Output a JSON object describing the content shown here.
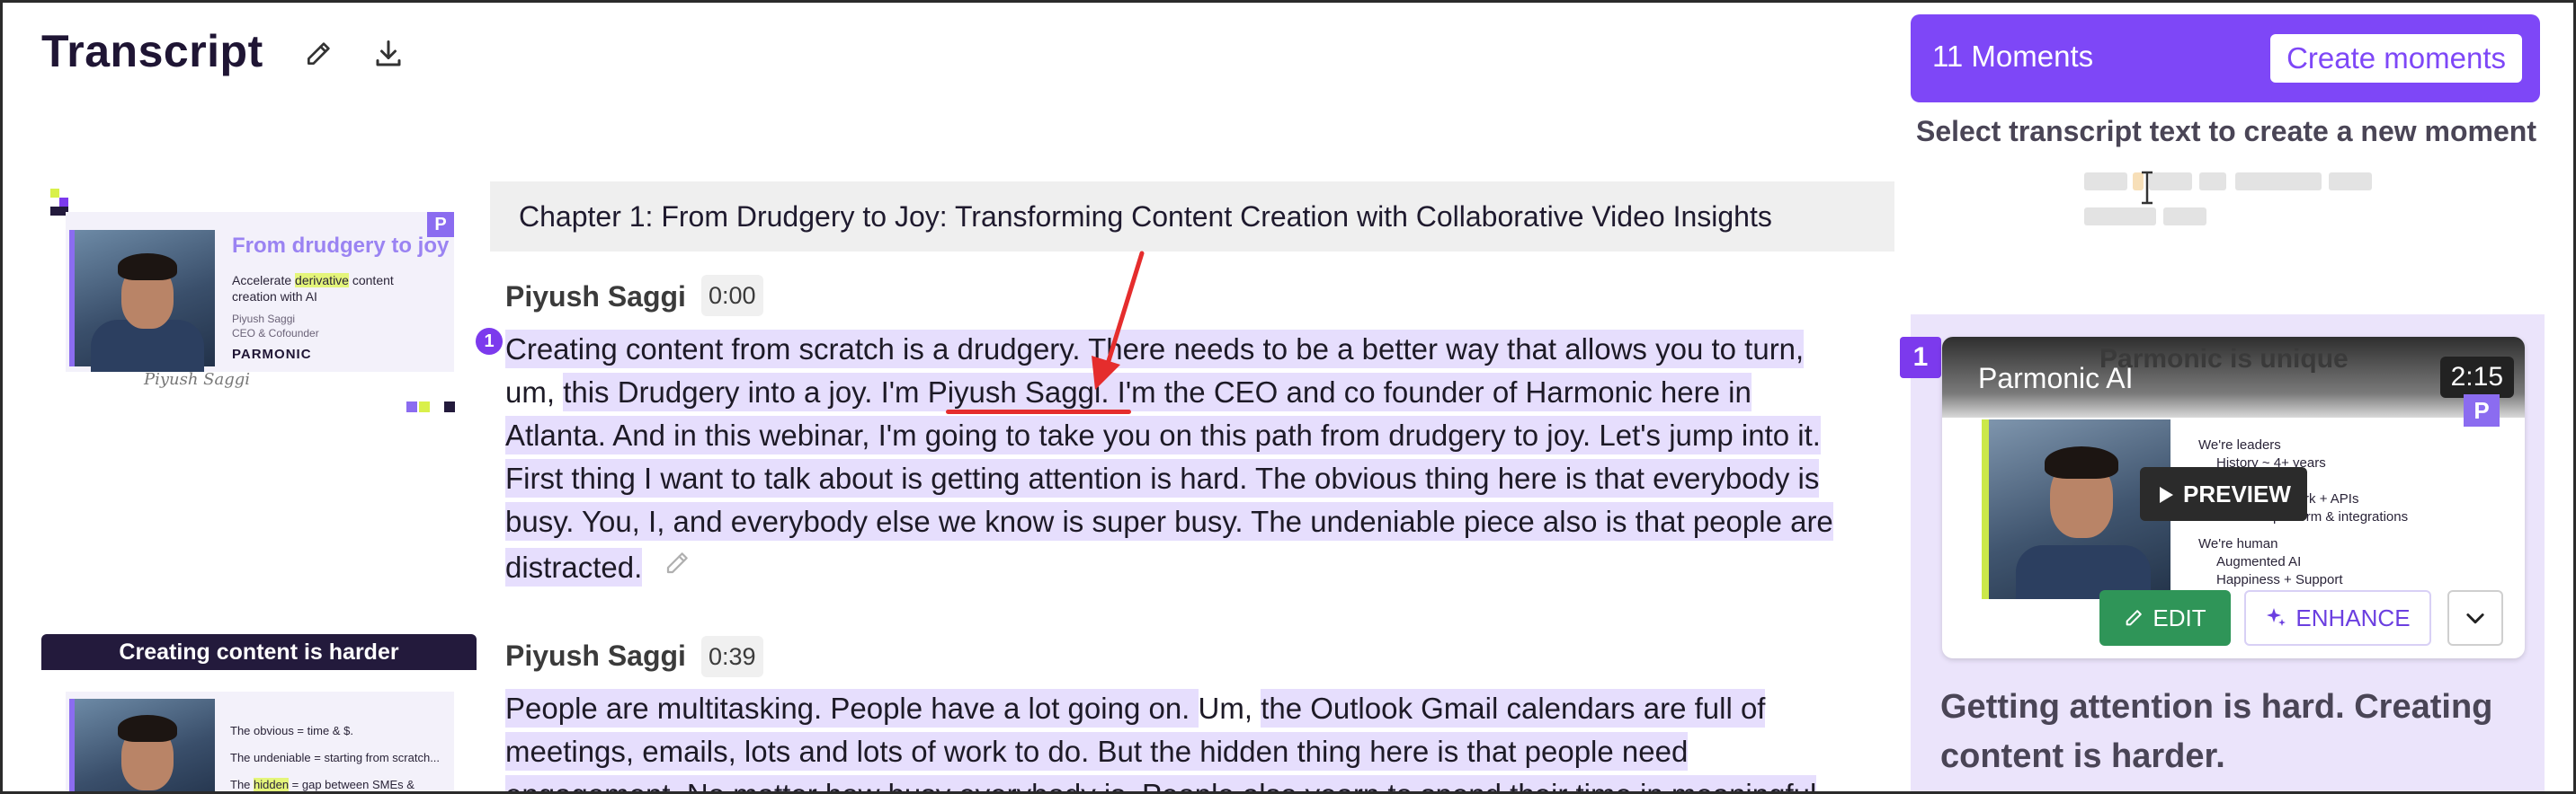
{
  "header": {
    "title": "Transcript",
    "edit_icon": "pencil-icon",
    "download_icon": "download-icon"
  },
  "thumbnails": [
    {
      "title": "From drudgery to joy",
      "line1_before": "Accelerate ",
      "line1_highlight": "derivative",
      "line1_after": " content",
      "line2": "creation with AI",
      "name": "Piyush Saggi",
      "role": "CEO & Cofounder",
      "brand": "PARMONIC",
      "badge": "P",
      "signature": "Piyush Saggi"
    },
    {
      "heading": "Creating content is harder",
      "line1": "The obvious = time & $.",
      "line2": "The undeniable = starting from scratch...",
      "line3_before": "The ",
      "line3_highlight": "hidden",
      "line3_after": " = gap between SMEs &"
    }
  ],
  "chapter": {
    "title": "Chapter 1: From Drudgery to Joy: Transforming Content Creation with Collaborative Video Insights"
  },
  "segments": [
    {
      "speaker": "Piyush Saggi",
      "timestamp": "0:00",
      "moment_number": "1",
      "lines": [
        "Creating content from scratch is a drudgery. There needs to be a better way that allows you to turn,",
        "this Drudgery into a joy. I'm Piyush Saggi. I'm the CEO and co founder of Harmonic here in",
        "Atlanta. And in this webinar, I'm going to take you on this path from drudgery to joy. Let's jump into it.",
        "First thing I want to talk about is getting attention is hard. The obvious thing here is that everybody is",
        "busy. You, I, and everybody else we know is super busy. The undeniable piece also is that people are",
        "distracted."
      ],
      "line2_prefix": "um, "
    },
    {
      "speaker": "Piyush Saggi",
      "timestamp": "0:39",
      "lines": [
        "People are multitasking. People have a lot going on. ",
        "Um, ",
        "the Outlook Gmail calendars are full of",
        "meetings, emails, lots and lots of work to do. But the hidden thing here is that people need",
        "engagement. No matter how busy everybody is. People also yearn to spend their time in meaningful"
      ]
    }
  ],
  "moments": {
    "count_label": "11 Moments",
    "create_label": "Create moments",
    "hint": "Select transcript text to create a new moment",
    "cards": [
      {
        "number": "1",
        "video_title": "Parmonic AI",
        "slide_title": "Parmonic is unique",
        "duration": "2:15",
        "badge": "P",
        "slide_items": [
          "We're leaders",
          "History ~ 4+ years",
          "s",
          "ginal work + APIs",
          "ve platform & integrations",
          "We're human",
          "Augmented AI",
          "Happiness + Support"
        ],
        "preview_label": "PREVIEW",
        "edit_label": "EDIT",
        "enhance_label": "ENHANCE",
        "description_lines": [
          "Getting attention is hard. Creating",
          "content is harder."
        ]
      }
    ]
  },
  "colors": {
    "accent": "#7e47f7",
    "highlight": "#e6defd",
    "annotation": "#e52d2d",
    "edit_green": "#2f9558"
  }
}
